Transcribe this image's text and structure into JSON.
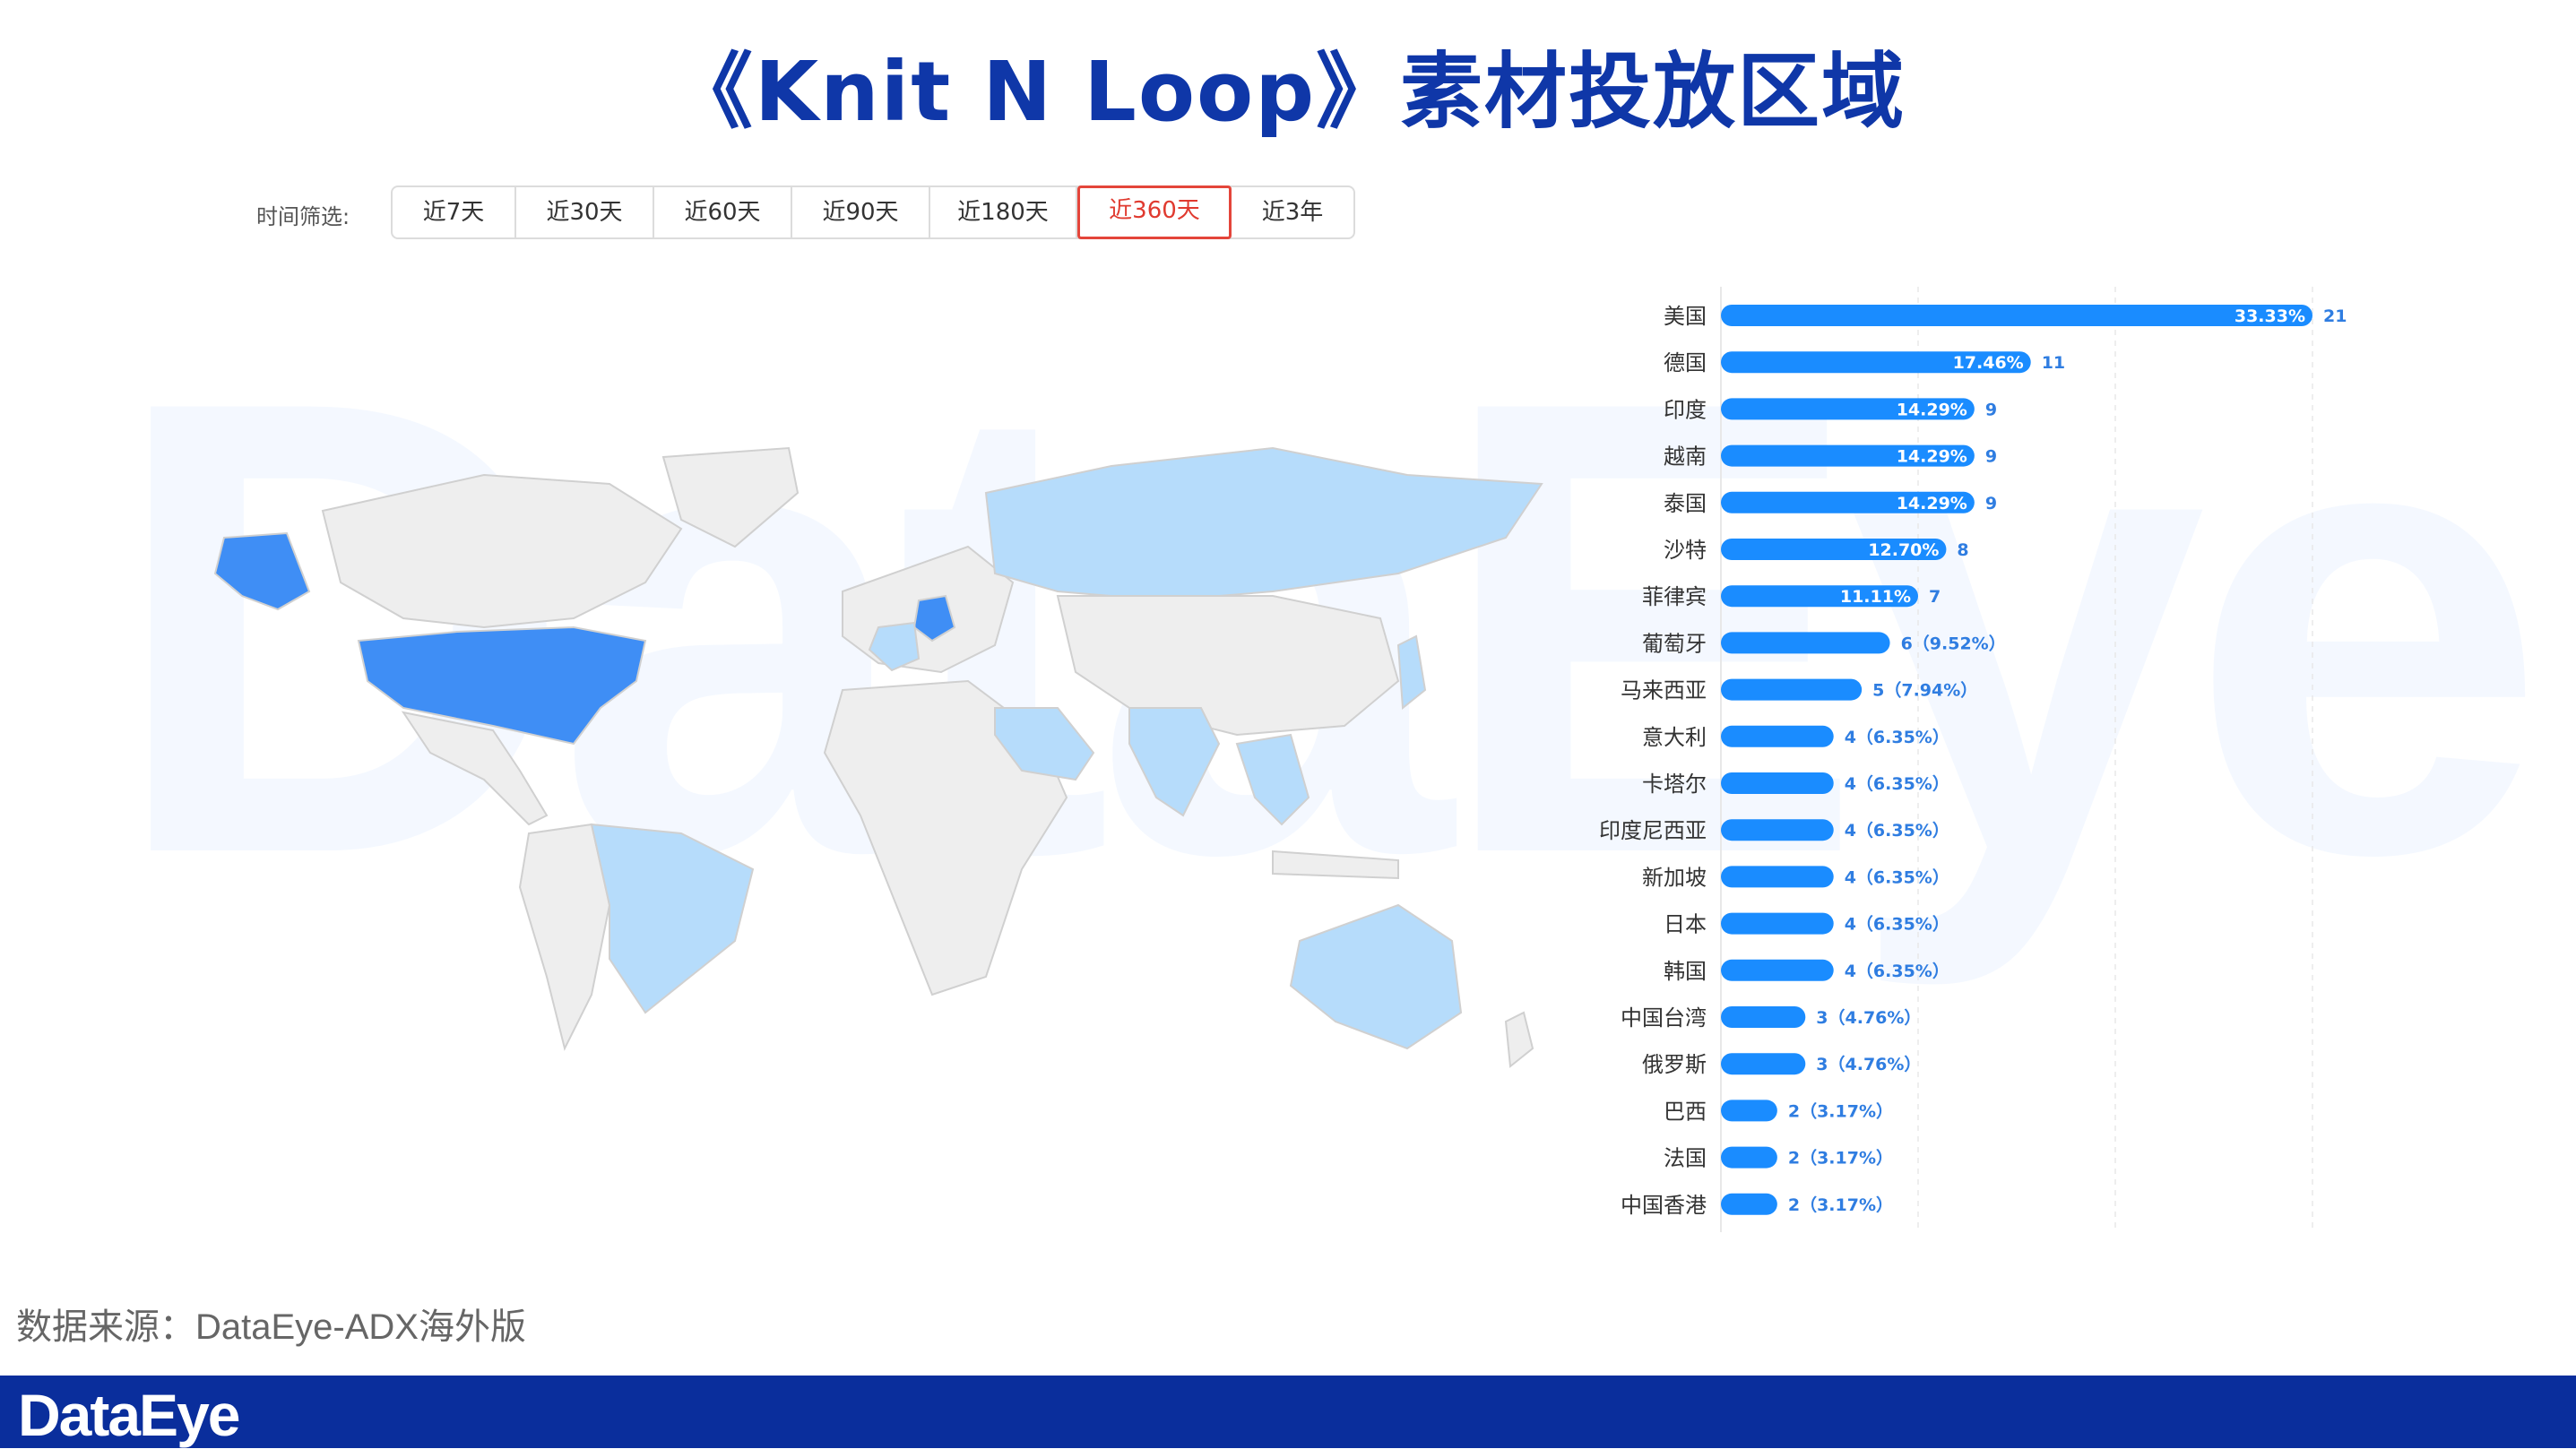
{
  "title": "《Knit N Loop》素材投放区域",
  "watermark": "DataEye",
  "filter": {
    "label": "时间筛选:",
    "options": [
      "近7天",
      "近30天",
      "近60天",
      "近90天",
      "近180天",
      "近360天",
      "近3年"
    ],
    "selected": "近360天"
  },
  "map": {
    "highlighted_regions": [
      "美国",
      "阿拉斯加",
      "德国",
      "印度",
      "沙特",
      "俄罗斯",
      "巴西",
      "澳大利亚",
      "法国",
      "东南亚"
    ],
    "colors": {
      "strong": "#3f8ef5",
      "light": "#b6dcfb",
      "base": "#eeeeee"
    }
  },
  "chart_data": {
    "type": "bar",
    "orientation": "horizontal",
    "categories": [
      "美国",
      "德国",
      "印度",
      "越南",
      "泰国",
      "沙特",
      "菲律宾",
      "葡萄牙",
      "马来西亚",
      "意大利",
      "卡塔尔",
      "印度尼西亚",
      "新加坡",
      "日本",
      "韩国",
      "中国台湾",
      "俄罗斯",
      "巴西",
      "法国",
      "中国香港"
    ],
    "values": [
      21,
      11,
      9,
      9,
      9,
      8,
      7,
      6,
      5,
      4,
      4,
      4,
      4,
      4,
      4,
      3,
      3,
      2,
      2,
      2
    ],
    "percents": [
      "33.33%",
      "17.46%",
      "14.29%",
      "14.29%",
      "14.29%",
      "12.70%",
      "11.11%",
      "9.52%",
      "7.94%",
      "6.35%",
      "6.35%",
      "6.35%",
      "6.35%",
      "6.35%",
      "6.35%",
      "4.76%",
      "4.76%",
      "3.17%",
      "3.17%",
      "3.17%"
    ],
    "xlim": [
      0,
      21
    ],
    "color": "#1a8cff"
  },
  "source": "数据来源：DataEye-ADX海外版",
  "footer": {
    "logo": "DataEye"
  }
}
